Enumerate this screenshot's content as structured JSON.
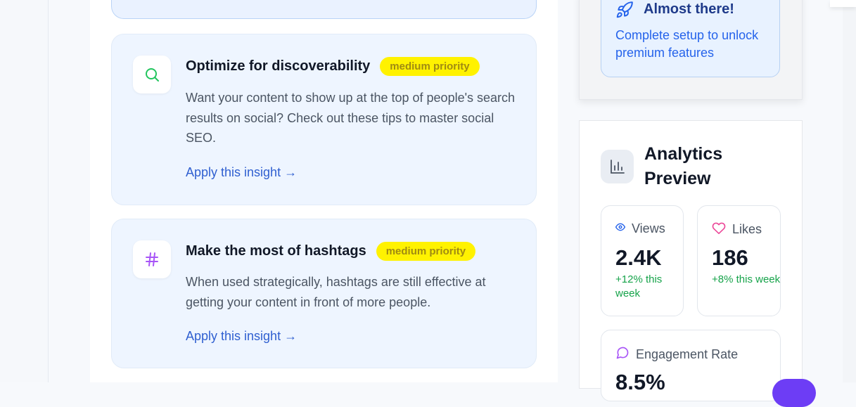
{
  "insights": [
    {
      "title": "Optimize for discoverability",
      "priority": "medium priority",
      "description": "Want your content to show up at the top of people's search results on social? Check out these tips to master social SEO.",
      "link": "Apply this insight →",
      "icon": "search-icon",
      "icon_color": "#22c55e"
    },
    {
      "title": "Make the most of hashtags",
      "priority": "medium priority",
      "description": "When used strategically, hashtags are still effective at getting your content in front of more people.",
      "link": "Apply this insight →",
      "icon": "hashtag-icon",
      "icon_color": "#a855f7"
    }
  ],
  "setup": {
    "title": "Almost there!",
    "text": "Complete setup to unlock premium features",
    "icon": "rocket-icon"
  },
  "analytics": {
    "title": "Analytics Preview",
    "icon": "bar-chart-icon",
    "views": {
      "label": "Views",
      "value": "2.4K",
      "change": "+12% this week",
      "icon": "eye-icon"
    },
    "likes": {
      "label": "Likes",
      "value": "186",
      "change": "+8% this week",
      "icon": "heart-icon"
    },
    "engagement": {
      "label": "Engagement Rate",
      "value": "8.5%",
      "icon": "message-circle-icon"
    }
  },
  "colors": {
    "accent_blue": "#2f5fd0",
    "badge_yellow": "#fff200",
    "positive_green": "#16a34a",
    "purple": "#a855f7"
  }
}
